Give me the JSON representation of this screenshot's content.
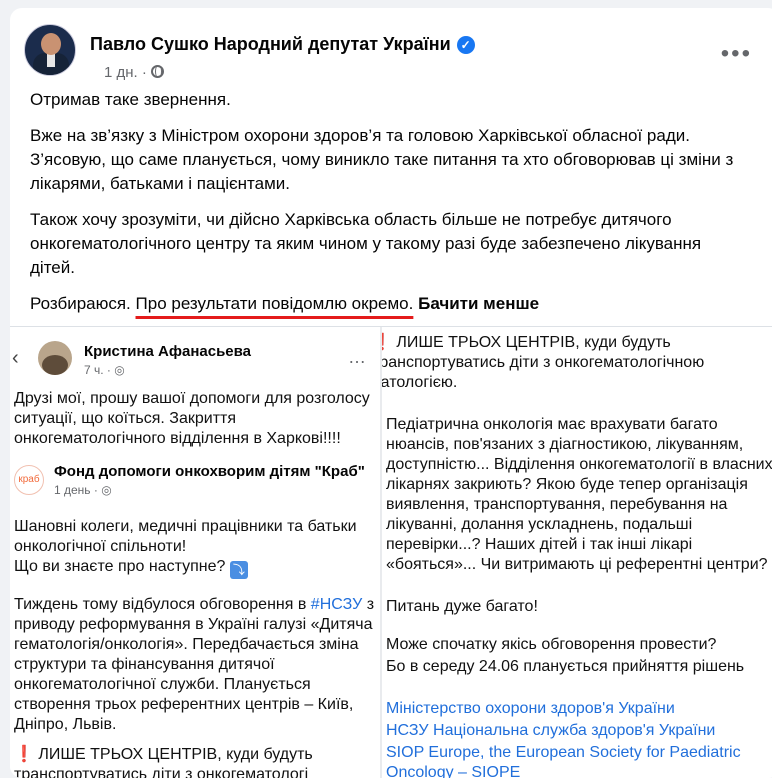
{
  "post": {
    "author": "Павло Сушко Народний депутат України",
    "time": "1 дн.",
    "more": "•••",
    "paragraphs": {
      "p1": "Отримав таке звернення.",
      "p2": "Вже на зв’язку з Міністром охорони здоров’я та головою Харківської обласної ради. З’ясовую, що саме планується, чому виникло таке питання та хто обговорював ці зміни з лікарями, батьками і пацієнтами.",
      "p3": "Також хочу зрозуміти, чи дійсно Харківська область більше не потребує дитячого онкогематологічного центру та яким чином у такому разі буде забезпечено лікування дітей.",
      "p4_start": "Розбираюся. ",
      "p4_underlined": "Про результати повідомлю окремо.",
      "see_less": "Бачити менше"
    }
  },
  "left_image": {
    "back": "‹",
    "name": "Кристина Афанасьева",
    "time": "7 ч. · ◎",
    "dots": "…",
    "text1": "Друзі мої, прошу вашої допомоги для розголосу ситуації, що коїться. Закриття онкогематологічного відділення в Харкові!!!!",
    "fund_logo": "краб",
    "fund_name": "Фонд допомоги онкохворим дітям \"Краб\"",
    "fund_time": "1 день · ◎",
    "text2": "Шановні колеги, медичні працівники та батьки онкологічної спільноти!",
    "text3": "Що ви знаєте про наступне?",
    "emoji": "⤵",
    "text4_a": "Тиждень тому відбулося обговорення в ",
    "hashtag": "#НСЗУ",
    "text4_b": " з приводу реформування в Україні галузі «Дитяча гематологія/онкологія». Передбачається зміна структури та фінансування дитячої онкогематологічної служби. Планується створення трьох референтних центрів – Київ, Дніпро, Львів.",
    "mark": "❗",
    "text5": "ЛИШЕ ТРЬОХ ЦЕНТРІВ, куди будуть транспортуватись діти з онкогематологі"
  },
  "right_image": {
    "mark": "❗",
    "text1": "ЛИШЕ ТРЬОХ ЦЕНТРІВ, куди будуть",
    "text1b": "транспортуватись діти з онкогематологічною патологією.",
    "text2": "Педіатрична онкологія має врахувати багато нюансів, пов'язаних з діагностикою, лікуванням, доступністю... Відділення онкогематології в власних лікарнях закриють? Якою буде тепер організація виявлення, транспортування, перебування на лікуванні, долання ускладнень, подальші перевірки...? Наших дітей і так інші лікарі «бояться»... Чи витримають ці референтні центри?",
    "text3": "Питань дуже багато!",
    "text4": "Може спочатку якісь обговорення провести?",
    "text5": "Бо в середу 24.06 планується прийняття рішень",
    "link1": "Міністерство охорони здоров'я України",
    "link2": "НСЗУ Національна служба здоров'я України",
    "link3": "SIOP Europe, the European Society for Paediatric Oncology – SIOPE"
  }
}
